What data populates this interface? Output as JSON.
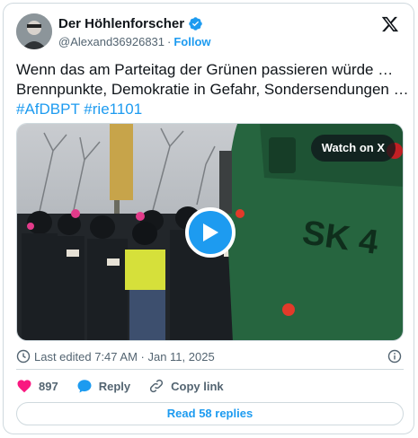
{
  "author": {
    "display_name": "Der Höhlenforscher",
    "handle": "@Alexand36926831",
    "separator": "·",
    "follow_label": "Follow"
  },
  "tweet": {
    "line1": "Wenn das am Parteitag der Grünen passieren würde …",
    "line2": "Brennpunkte, Demokratie in Gefahr, Sondersendungen …",
    "hashtag1": "#AfDBPT",
    "hashtag2": "#rie1101"
  },
  "media": {
    "watch_label": "Watch on X",
    "vehicle_text": "SK 4"
  },
  "meta": {
    "edited_text": "Last edited 7:47 AM · Jan 11, 2025"
  },
  "actions": {
    "like_count": "897",
    "reply_label": "Reply",
    "copy_label": "Copy link"
  },
  "footer": {
    "read_replies_label": "Read 58 replies"
  },
  "colors": {
    "accent": "#1d9bf0",
    "like": "#f91880",
    "text": "#0f1419",
    "muted": "#536471",
    "border": "#cfd9de"
  },
  "icons": [
    "verified-badge-icon",
    "x-logo-icon",
    "play-icon",
    "clock-icon",
    "info-icon",
    "heart-icon",
    "reply-bubble-icon",
    "link-icon"
  ]
}
